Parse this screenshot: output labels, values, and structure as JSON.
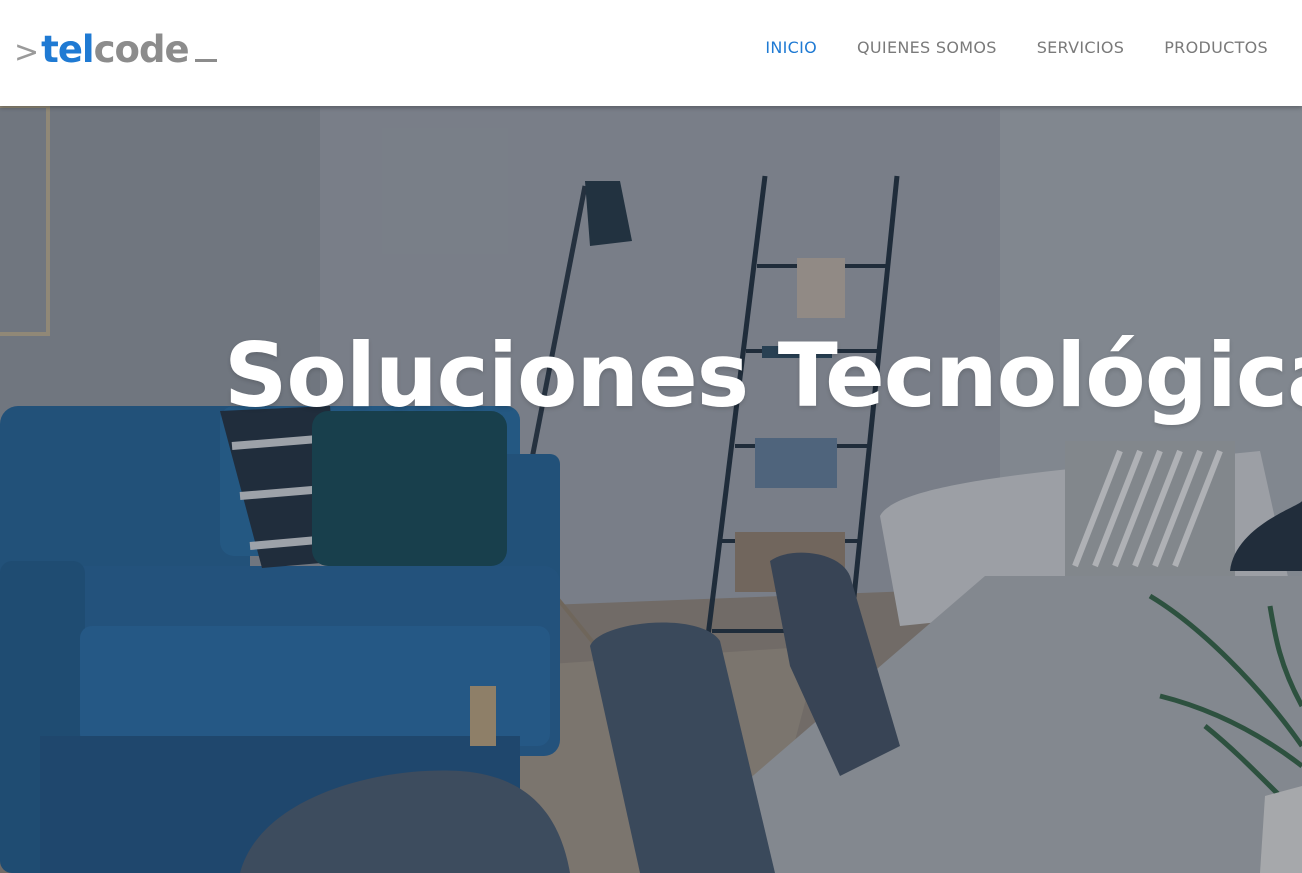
{
  "brand": {
    "prefix": ">",
    "part1": "tel",
    "part2": "code",
    "accent_color": "#1f7ad3",
    "gray_color": "#8c8c8c"
  },
  "nav": {
    "items": [
      {
        "label": "INICIO",
        "active": true
      },
      {
        "label": "QUIENES SOMOS",
        "active": false
      },
      {
        "label": "SERVICIOS",
        "active": false
      },
      {
        "label": "PRODUCTOS",
        "active": false
      }
    ]
  },
  "hero": {
    "title": "Soluciones Tecnológicas"
  }
}
